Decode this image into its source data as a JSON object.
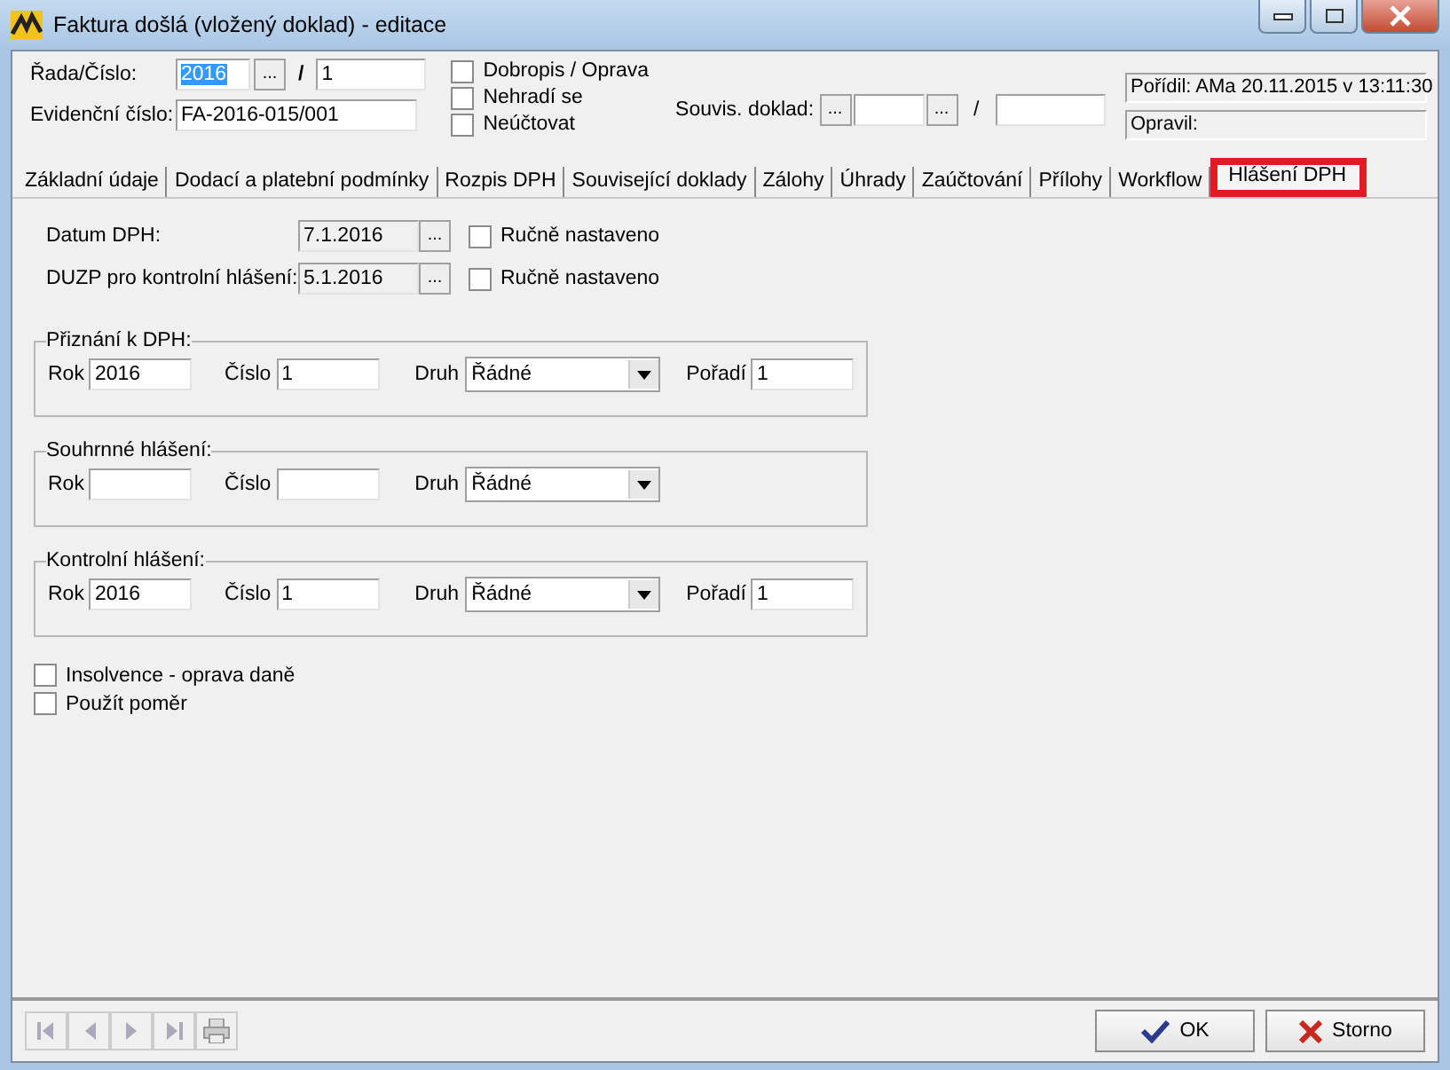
{
  "window": {
    "title": "Faktura došlá (vložený doklad) - editace"
  },
  "header": {
    "rada_label": "Řada/Číslo:",
    "rada_value": "2016",
    "rada_highlighted": true,
    "rada_browse": "...",
    "slash": "/",
    "cislo_value": "1",
    "evidencni_label": "Evidenční číslo:",
    "evidencni_value": "FA-2016-015/001",
    "flags": [
      {
        "label": "Dobropis / Oprava",
        "checked": false
      },
      {
        "label": "Nehradí se",
        "checked": false
      },
      {
        "label": "Neúčtovat",
        "checked": false
      }
    ],
    "souvis_label": "Souvis. doklad:",
    "souvis_browse": "...",
    "souvis_browse_2": "...",
    "souvis_slash": "/",
    "poridil": "Pořídil: AMa 20.11.2015 v 13:11:30",
    "opravil": "Opravil:"
  },
  "tabs": [
    {
      "label": "Základní údaje",
      "selected": false
    },
    {
      "label": "Dodací a platební podmínky",
      "selected": false
    },
    {
      "label": "Rozpis DPH",
      "selected": false
    },
    {
      "label": "Související doklady",
      "selected": false
    },
    {
      "label": "Zálohy",
      "selected": false
    },
    {
      "label": "Úhrady",
      "selected": false
    },
    {
      "label": "Zaúčtování",
      "selected": false
    },
    {
      "label": "Přílohy",
      "selected": false
    },
    {
      "label": "Workflow",
      "selected": false
    },
    {
      "label": "Hlášení DPH",
      "selected": true
    }
  ],
  "dates": [
    {
      "label": "Datum DPH:",
      "value": "7.1.2016",
      "browse": "...",
      "manual_label": "Ručně nastaveno",
      "checked": false
    },
    {
      "label": "DUZP pro kontrolní hlášení:",
      "value": "5.1.2016",
      "browse": "...",
      "manual_label": "Ručně nastaveno",
      "checked": false
    }
  ],
  "groups": [
    {
      "title": "Přiznání k DPH:",
      "rok_label": "Rok",
      "rok": "2016",
      "cislo_label": "Číslo",
      "cislo": "1",
      "druh_label": "Druh",
      "druh": "Řádné",
      "poradi_label": "Pořadí",
      "poradi": "1"
    },
    {
      "title": "Souhrnné hlášení:",
      "rok_label": "Rok",
      "cislo_label": "Číslo",
      "druh_label": "Druh",
      "druh": "Řádné"
    },
    {
      "title": "Kontrolní hlášení:",
      "rok_label": "Rok",
      "rok": "2016",
      "cislo_label": "Číslo",
      "cislo": "1",
      "druh_label": "Druh",
      "druh": "Řádné",
      "poradi_label": "Pořadí",
      "poradi": "1"
    }
  ],
  "options": [
    {
      "label": "Insolvence - oprava daně",
      "checked": false
    },
    {
      "label": "Použít poměr",
      "checked": false
    }
  ],
  "buttons": [
    {
      "label": "OK",
      "kind": "ok"
    },
    {
      "label": "Storno",
      "kind": "cancel"
    }
  ]
}
